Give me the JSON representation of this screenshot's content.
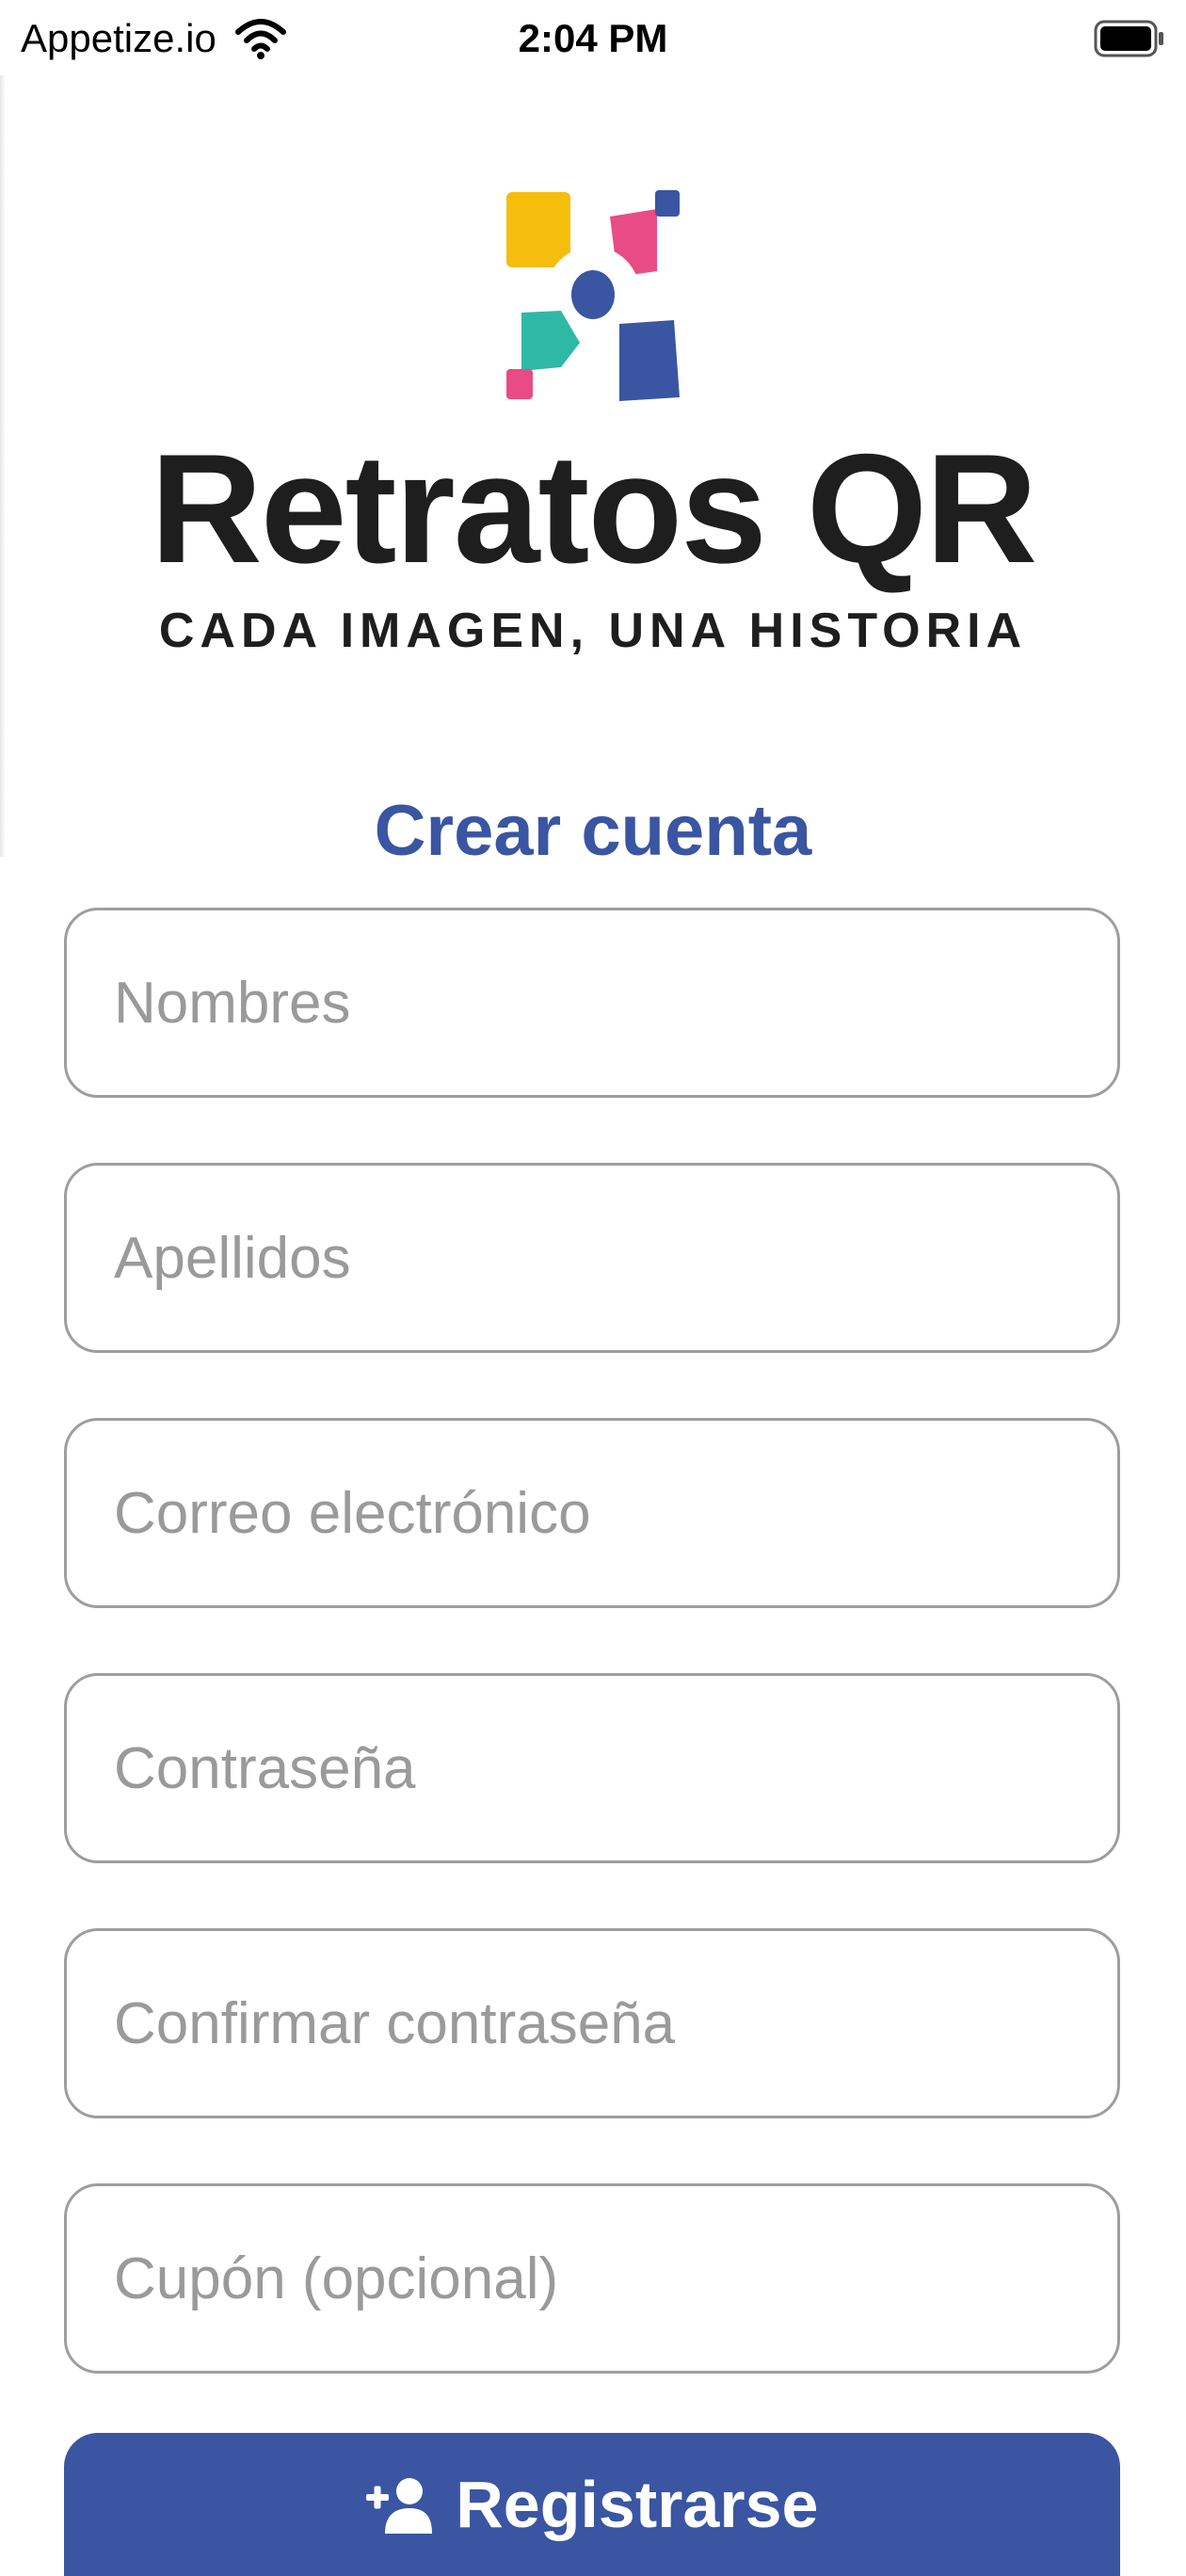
{
  "status_bar": {
    "carrier": "Appetize.io",
    "time": "2:04 PM"
  },
  "brand": {
    "name": "Retratos QR",
    "tagline": "CADA IMAGEN, UNA HISTORIA",
    "logo_colors": [
      "#f5bd0c",
      "#e94b86",
      "#3a55a2",
      "#2fb8a6"
    ]
  },
  "form": {
    "title": "Crear cuenta",
    "fields": {
      "nombres": {
        "placeholder": "Nombres",
        "value": ""
      },
      "apellidos": {
        "placeholder": "Apellidos",
        "value": ""
      },
      "correo": {
        "placeholder": "Correo electrónico",
        "value": ""
      },
      "contrasena": {
        "placeholder": "Contraseña",
        "value": ""
      },
      "confirmar": {
        "placeholder": "Confirmar contraseña",
        "value": ""
      },
      "cupon": {
        "placeholder": "Cupón (opcional)",
        "value": ""
      }
    },
    "submit_label": "Registrarse",
    "submit_icon": "add-user-icon"
  },
  "colors": {
    "accent": "#3a55a2",
    "field_border": "#9e9e9e",
    "placeholder": "#9a9a9a",
    "text_dark": "#1e1e1e"
  }
}
